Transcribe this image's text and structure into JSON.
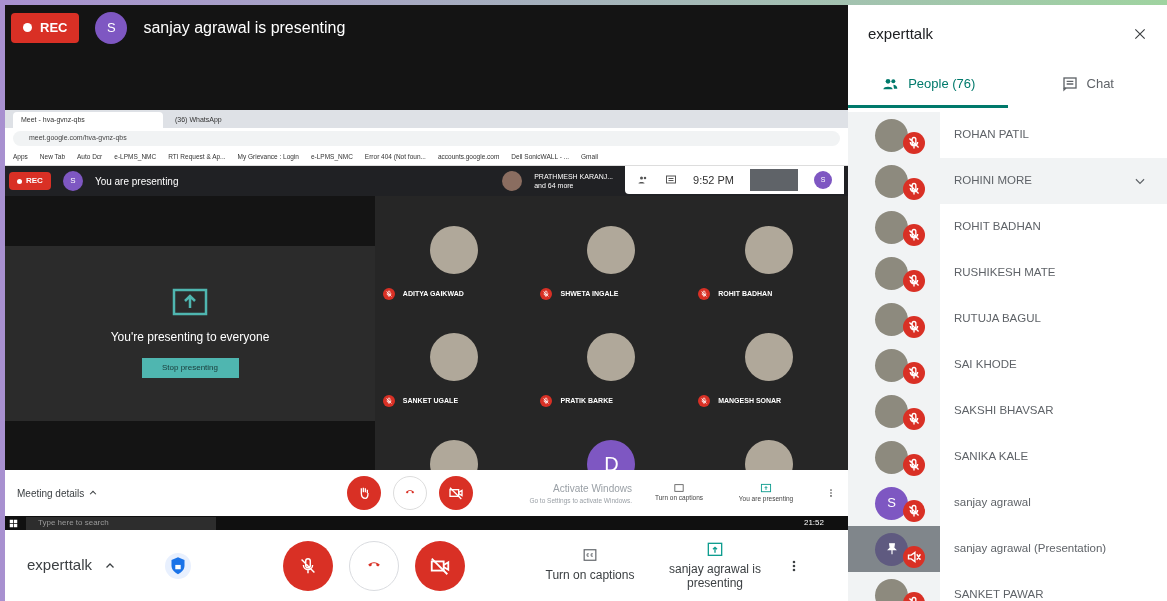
{
  "top_bar": {
    "rec": "REC",
    "initial": "S",
    "text": "sanjay agrawal is presenting"
  },
  "inner_browser": {
    "tabs": [
      {
        "title": "Meet - hva-gvnz-qbs",
        "selected": true
      },
      {
        "title": "(36) WhatsApp",
        "selected": false
      }
    ],
    "address": "meet.google.com/hva-gvnz-qbs",
    "bookmarks": [
      "Apps",
      "New Tab",
      "Auto Dcr",
      "e-LPMS_NMC",
      "RTI Request & Ap...",
      "My Grievance : Login",
      "e-LPMS_NMC",
      "Error 404 (Not foun...",
      "accounts.google.com",
      "Dell SonicWALL - ...",
      "Gmail"
    ],
    "meet_bar": {
      "rec": "REC",
      "initial": "S",
      "text": "You are presenting",
      "participant": "PRATHMESH KARANJ...",
      "more": "and 64 more",
      "time": "9:52 PM",
      "self_initial": "S"
    },
    "presenting": {
      "text": "You're presenting to everyone",
      "button": "Stop presenting"
    },
    "grid": [
      {
        "kind": "photo",
        "name": "ADITYA GAIKWAD"
      },
      {
        "kind": "photo",
        "name": "SHWETA INGALE"
      },
      {
        "kind": "photo",
        "name": "ROHIT BADHAN"
      },
      {
        "kind": "photo",
        "name": "SANKET UGALE"
      },
      {
        "kind": "photo",
        "name": "PRATIK BARKE"
      },
      {
        "kind": "photo",
        "name": "MANGESH SONAR"
      },
      {
        "kind": "photo"
      },
      {
        "kind": "letter",
        "letter": "D"
      },
      {
        "kind": "photo"
      }
    ],
    "controls": {
      "details": "Meeting details",
      "captions": "Turn on captions",
      "presenting": "You are presenting"
    },
    "activation": {
      "title": "Activate Windows",
      "text": "Go to Settings to activate Windows."
    },
    "taskbar": {
      "search": "Type here to search",
      "time": "21:52"
    }
  },
  "panel": {
    "title": "experttalk",
    "tabs": [
      {
        "label": "People (76)",
        "selected": true
      },
      {
        "label": "Chat",
        "selected": false
      }
    ],
    "people": [
      {
        "kind": "photo",
        "name": "ROHAN PATIL",
        "hovered": false
      },
      {
        "kind": "photo",
        "name": "ROHINI MORE",
        "hovered": true
      },
      {
        "kind": "photo",
        "name": "ROHIT BADHAN",
        "hovered": false
      },
      {
        "kind": "photo",
        "name": "RUSHIKESH MATE",
        "hovered": false
      },
      {
        "kind": "photo",
        "name": "RUTUJA BAGUL",
        "hovered": false
      },
      {
        "kind": "photo",
        "name": "SAI KHODE",
        "hovered": false
      },
      {
        "kind": "photo",
        "name": "SAKSHI BHAVSAR",
        "hovered": false
      },
      {
        "kind": "photo",
        "name": "SANIKA KALE",
        "hovered": false
      },
      {
        "kind": "letter",
        "name": "sanjay agrawal",
        "letter": "S",
        "hovered": false
      },
      {
        "kind": "presentation",
        "name": "sanjay agrawal (Presentation)",
        "hovered": false
      },
      {
        "kind": "photo",
        "name": "SANKET PAWAR",
        "hovered": false
      }
    ]
  },
  "bottom_bar": {
    "meeting": "experttalk",
    "captions": "Turn on captions",
    "presenting": "sanjay agrawal is presenting"
  }
}
